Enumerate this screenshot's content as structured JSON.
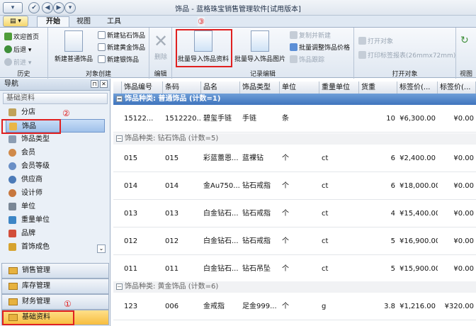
{
  "window": {
    "title": "饰品 - 蓝格珠宝销售管理软件[试用版本]"
  },
  "tabs": [
    "开始",
    "视图",
    "工具"
  ],
  "ribbon": {
    "history": {
      "label": "历史",
      "home": "欢迎首页",
      "back": "后退",
      "forward": "前进"
    },
    "create": {
      "label": "对象创建",
      "new_normal": "新建普通饰品",
      "new_diamond": "新建钻石饰品",
      "new_gold": "新建黄金饰品",
      "new_silver": "新建银饰品"
    },
    "edit": {
      "label": "编辑",
      "delete": "删除"
    },
    "records": {
      "label": "记录编辑",
      "batch_import": "批量导入饰品资料",
      "batch_image": "批量导入饰品图片",
      "copy_new": "复制并新建",
      "batch_price": "批量调整饰品价格",
      "track": "饰品跟踪"
    },
    "open": {
      "label": "打开对象",
      "open_obj": "打开对象",
      "print_tag": "打印标签报表(26mmx72mm)"
    },
    "view": {
      "label": "视图"
    }
  },
  "annotations": [
    "①",
    "②",
    "③"
  ],
  "nav": {
    "header": "导航",
    "section": "基础资料",
    "items": [
      "分店",
      "饰品",
      "饰品类型",
      "会员",
      "会员等级",
      "供应商",
      "设计师",
      "单位",
      "重量单位",
      "品牌",
      "首饰成色"
    ],
    "categories": [
      "销售管理",
      "库存管理",
      "财务管理",
      "基础资料"
    ]
  },
  "grid": {
    "columns": [
      "饰品编号",
      "条码",
      "品名",
      "饰品类型",
      "单位",
      "重量单位",
      "货重",
      "标签价(...",
      "标签价(..."
    ],
    "groups": [
      {
        "label": "饰品种类: 普通饰品 (计数=1)",
        "rows": [
          [
            "15122...",
            "1512220...",
            "碧玺手链",
            "手链",
            "条",
            "",
            "10",
            "¥6,300.00",
            "¥0.00"
          ]
        ]
      },
      {
        "label": "饰品种类: 钻石饰品 (计数=5)",
        "rows": [
          [
            "015",
            "015",
            "彩蓝蕾恩...",
            "蓝裸钻",
            "个",
            "ct",
            "6",
            "¥2,400.00",
            "¥0.00"
          ],
          [
            "014",
            "014",
            "金Au750...",
            "钻石戒指",
            "个",
            "ct",
            "6",
            "¥18,000.00",
            "¥0.00"
          ],
          [
            "013",
            "013",
            "白金钻石...",
            "钻石戒指",
            "个",
            "ct",
            "4",
            "¥15,400.00",
            "¥0.00"
          ],
          [
            "012",
            "012",
            "白金钻石...",
            "钻石戒指",
            "个",
            "ct",
            "5",
            "¥16,900.00",
            "¥0.00"
          ],
          [
            "011",
            "011",
            "白金钻石...",
            "钻石吊坠",
            "个",
            "ct",
            "5",
            "¥15,900.00",
            "¥0.00"
          ]
        ]
      },
      {
        "label": "饰品种类: 黄金饰品 (计数=6)",
        "rows": [
          [
            "123",
            "006",
            "金戒指",
            "足金999...",
            "个",
            "g",
            "3.8",
            "¥1,216.00",
            "¥320.00"
          ]
        ]
      }
    ]
  }
}
